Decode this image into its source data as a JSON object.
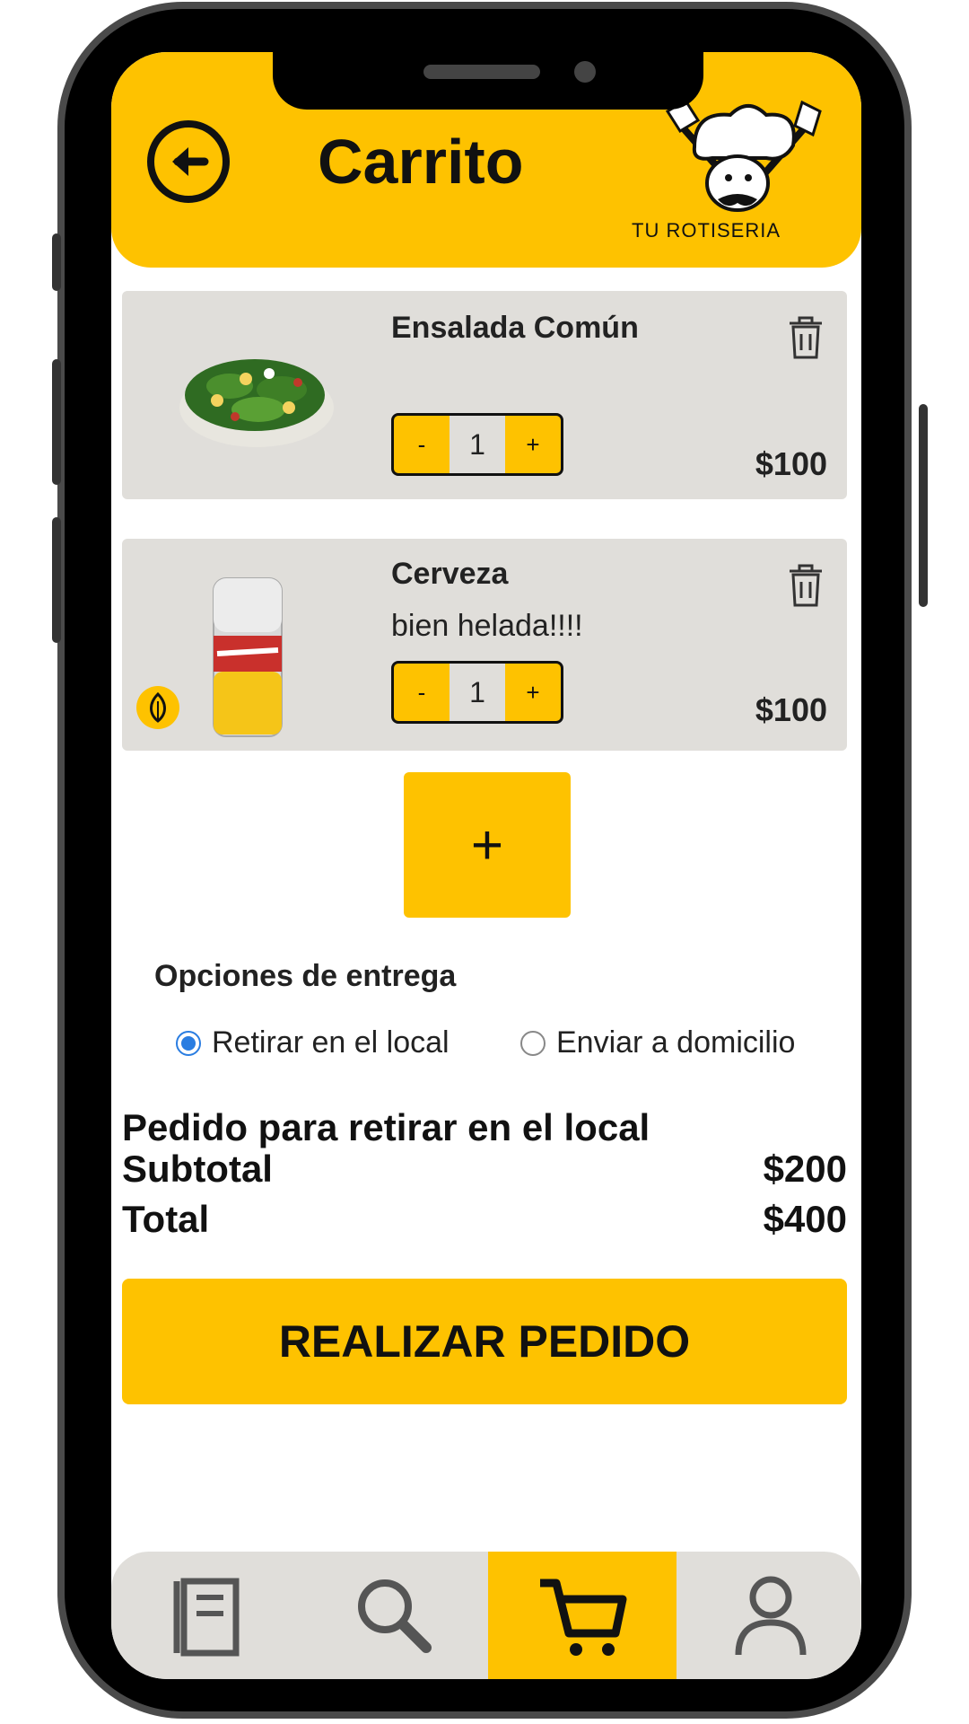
{
  "header": {
    "title": "Carrito",
    "brand": "TU ROTISERIA"
  },
  "cart": {
    "items": [
      {
        "name": "Ensalada Común",
        "note": "",
        "quantity": "1",
        "price": "$100",
        "minus": "-",
        "plus": "+"
      },
      {
        "name": "Cerveza",
        "note": "bien helada!!!!",
        "quantity": "1",
        "price": "$100",
        "minus": "-",
        "plus": "+"
      }
    ],
    "add_label": "+"
  },
  "delivery": {
    "label": "Opciones de entrega",
    "options": [
      {
        "label": "Retirar en el local",
        "selected": true
      },
      {
        "label": "Enviar a domicilio",
        "selected": false
      }
    ]
  },
  "summary": {
    "heading": "Pedido para retirar en el local",
    "subtotal_label": "Subtotal",
    "subtotal_value": "$200",
    "total_label": "Total",
    "total_value": "$400"
  },
  "cta_label": "REALIZAR PEDIDO",
  "tabs": [
    {
      "icon": "menu-book-icon",
      "active": false
    },
    {
      "icon": "search-icon",
      "active": false
    },
    {
      "icon": "cart-icon",
      "active": true
    },
    {
      "icon": "user-icon",
      "active": false
    }
  ],
  "colors": {
    "accent": "#FEC200",
    "card": "#E0DEDA",
    "radio": "#2a7de1"
  }
}
